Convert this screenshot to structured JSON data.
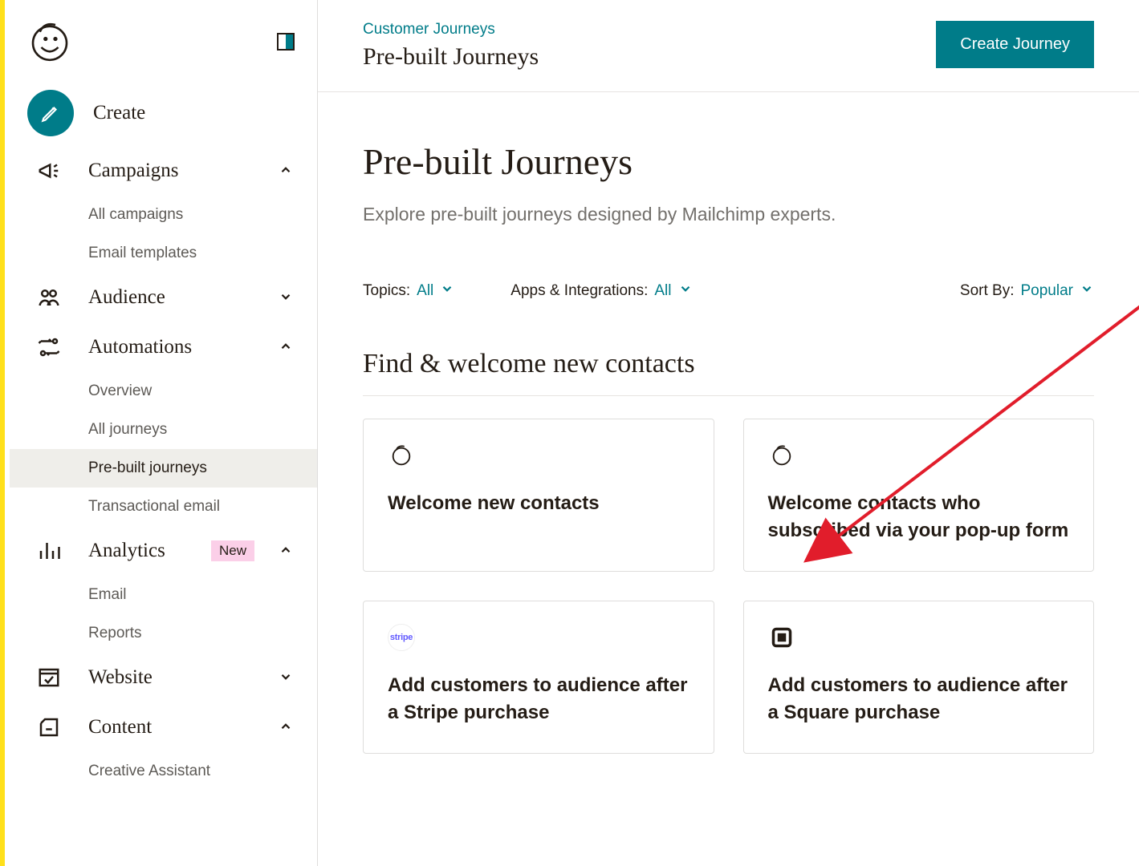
{
  "sidebar": {
    "create_label": "Create",
    "items": [
      {
        "label": "Campaigns",
        "expanded": true,
        "children": [
          "All campaigns",
          "Email templates"
        ]
      },
      {
        "label": "Audience",
        "expanded": false
      },
      {
        "label": "Automations",
        "expanded": true,
        "children": [
          "Overview",
          "All journeys",
          "Pre-built journeys",
          "Transactional email"
        ],
        "active_child": "Pre-built journeys"
      },
      {
        "label": "Analytics",
        "expanded": true,
        "badge": "New",
        "children": [
          "Email",
          "Reports"
        ]
      },
      {
        "label": "Website",
        "expanded": false
      },
      {
        "label": "Content",
        "expanded": true,
        "children": [
          "Creative Assistant"
        ]
      }
    ]
  },
  "header": {
    "breadcrumb": "Customer Journeys",
    "subtitle": "Pre-built Journeys",
    "primary_action": "Create Journey"
  },
  "page": {
    "title": "Pre-built Journeys",
    "lead": "Explore pre-built journeys designed by Mailchimp experts."
  },
  "filters": {
    "topics_label": "Topics:",
    "topics_value": "All",
    "apps_label": "Apps & Integrations:",
    "apps_value": "All",
    "sort_label": "Sort By:",
    "sort_value": "Popular"
  },
  "section": {
    "heading": "Find & welcome new contacts",
    "cards": [
      {
        "title": "Welcome new contacts",
        "icon": "mailchimp"
      },
      {
        "title": "Welcome contacts who subscribed via your pop-up form",
        "icon": "mailchimp"
      },
      {
        "title": "Add customers to audience after a Stripe purchase",
        "icon": "stripe"
      },
      {
        "title": "Add customers to audience after a Square purchase",
        "icon": "square"
      }
    ]
  }
}
